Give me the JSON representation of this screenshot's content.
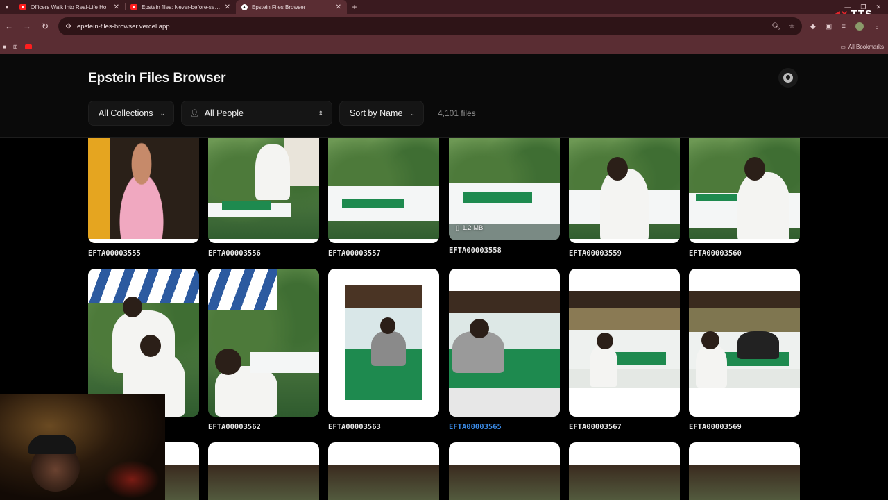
{
  "browser": {
    "tabs": [
      {
        "title": "Officers Walk Into Real-Life Ho",
        "favicon": "youtube-icon",
        "active": false
      },
      {
        "title": "Epstein files: Never-before-seen",
        "favicon": "youtube-icon",
        "active": false
      },
      {
        "title": "Epstein Files Browser",
        "favicon": "vercel-icon",
        "active": true
      }
    ],
    "url": "epstein-files-browser.vercel.app",
    "bookmarks_all_label": "All Bookmarks",
    "overlay_badge": "TTS"
  },
  "app": {
    "title": "Epstein Files Browser",
    "filters": {
      "collections": "All Collections",
      "people": "All People",
      "sort": "Sort by Name",
      "file_count": "4,101 files"
    }
  },
  "files": [
    {
      "name": "EFTA00003555"
    },
    {
      "name": "EFTA00003556"
    },
    {
      "name": "EFTA00003557"
    },
    {
      "name": "EFTA00003558",
      "size": "1.2 MB"
    },
    {
      "name": "EFTA00003559"
    },
    {
      "name": "EFTA00003560"
    },
    {
      "name": ""
    },
    {
      "name": "EFTA00003562"
    },
    {
      "name": "EFTA00003563"
    },
    {
      "name": "EFTA00003565",
      "hovered": true
    },
    {
      "name": "EFTA00003567"
    },
    {
      "name": "EFTA00003569"
    }
  ],
  "colors": {
    "background": "#000000",
    "header_bg": "#0a0a0a",
    "link_blue": "#3b8be6",
    "browser_frame": "#5a2d33"
  }
}
